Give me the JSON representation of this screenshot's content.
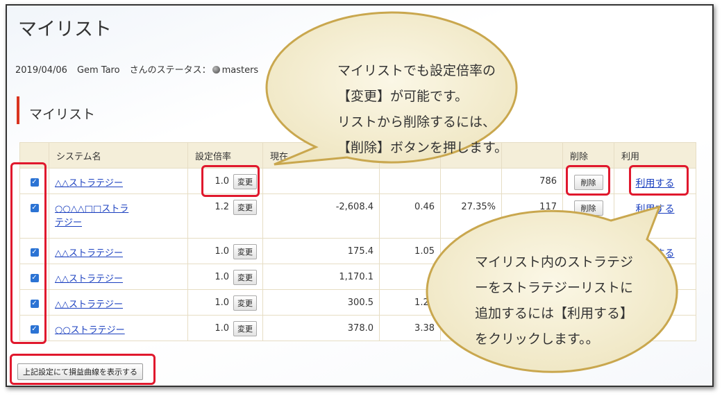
{
  "page": {
    "title": "マイリスト"
  },
  "status": {
    "date": "2019/04/06",
    "user_name": "Gem Taro",
    "status_label": "さんのステータス：",
    "status_value": "masters"
  },
  "section": {
    "title": "マイリスト"
  },
  "table": {
    "headers": {
      "system_name": "システム名",
      "multiplier": "設定倍率",
      "current": "現在",
      "delete": "削除",
      "use": "利用"
    },
    "change_label": "変更",
    "delete_label": "削除",
    "use_label": "利用する",
    "rows": [
      {
        "name": "△△ストラテジー",
        "multiplier": "1.0",
        "col_a": "",
        "col_b": "",
        "col_c": "",
        "col_d": "786",
        "checked": true
      },
      {
        "name": "○○△△□□ストラテジー",
        "multiplier": "1.2",
        "col_a": "-2,608.4",
        "col_b": "0.46",
        "col_c": "27.35%",
        "col_d": "117",
        "checked": true
      },
      {
        "name": "△△ストラテジー",
        "multiplier": "1.0",
        "col_a": "175.4",
        "col_b": "1.05",
        "col_c": "",
        "col_d": "",
        "checked": true
      },
      {
        "name": "△△ストラテジー",
        "multiplier": "1.0",
        "col_a": "1,170.1",
        "col_b": "-",
        "col_c": "",
        "col_d": "",
        "checked": true
      },
      {
        "name": "△△ストラテジー",
        "multiplier": "1.0",
        "col_a": "300.5",
        "col_b": "1.25",
        "col_c": "",
        "col_d": "",
        "checked": true
      },
      {
        "name": "○○ストラテジー",
        "multiplier": "1.0",
        "col_a": "378.0",
        "col_b": "3.38",
        "col_c": "",
        "col_d": "",
        "checked": true
      }
    ]
  },
  "show_curve_button": "上記設定にて損益曲線を表示する",
  "callouts": {
    "top": [
      "マイリストでも設定倍率の",
      "【変更】が可能です。",
      "リストから削除するには、",
      "【削除】ボタンを押します。"
    ],
    "bottom": [
      "マイリスト内のストラテジ",
      "ーをストラテジーリストに",
      "追加するには【利用する】",
      "をクリックします。。"
    ]
  },
  "colors": {
    "highlight": "#e0182d",
    "bubble_fill": "#f5efd6",
    "bubble_stroke": "#c9a74e",
    "link": "#1a3fbf",
    "section_bar": "#d9341f",
    "checkbox": "#2b73d4"
  }
}
